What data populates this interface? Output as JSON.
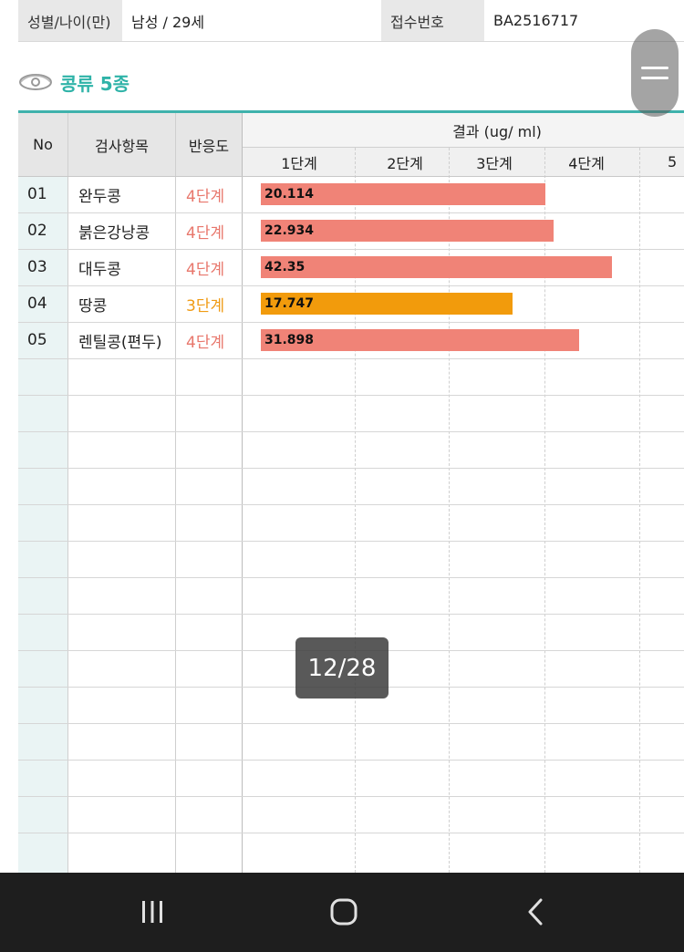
{
  "patient_info": {
    "gender_age_label": "성별/나이(만)",
    "gender_age_value": "남성 / 29세",
    "receipt_label": "접수번호",
    "receipt_value": "BA2516717"
  },
  "section": {
    "title": "콩류 5종",
    "icon": "eye-icon"
  },
  "table": {
    "headers": {
      "no": "No",
      "item": "검사항목",
      "reactivity": "반응도",
      "result": "결과 (ug/ ml)"
    },
    "stages": [
      "1단계",
      "2단계",
      "3단계",
      "4단계",
      "5"
    ],
    "rows": [
      {
        "no": "01",
        "item": "완두콩",
        "reactivity": "4단계",
        "value": "20.114",
        "level": 4,
        "bar_fraction": 0.67
      },
      {
        "no": "02",
        "item": "붉은강낭콩",
        "reactivity": "4단계",
        "value": "22.934",
        "level": 4,
        "bar_fraction": 0.69
      },
      {
        "no": "03",
        "item": "대두콩",
        "reactivity": "4단계",
        "value": "42.35",
        "level": 4,
        "bar_fraction": 0.83
      },
      {
        "no": "04",
        "item": "땅콩",
        "reactivity": "3단계",
        "value": "17.747",
        "level": 3,
        "bar_fraction": 0.59
      },
      {
        "no": "05",
        "item": "렌틸콩(편두)",
        "reactivity": "4단계",
        "value": "31.898",
        "level": 4,
        "bar_fraction": 0.75
      }
    ]
  },
  "colors": {
    "teal_accent": "#3fb2ac",
    "level4_text": "#e8776c",
    "level4_bar": "#f08377",
    "level3_text": "#f09b14",
    "level3_bar": "#f29b0c"
  },
  "pager": {
    "text": "12/28"
  },
  "navbar": {
    "recent_icon": "recent-apps-icon",
    "home_icon": "home-icon",
    "back_icon": "back-icon"
  }
}
